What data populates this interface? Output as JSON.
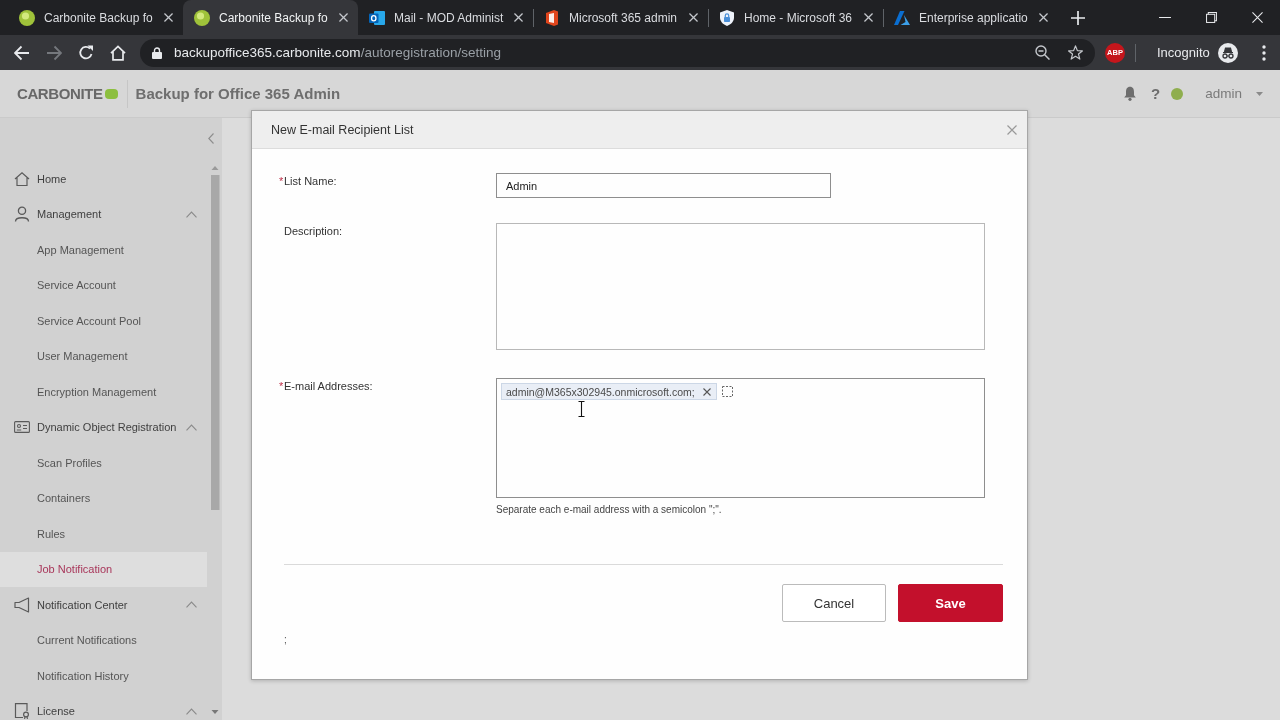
{
  "browser": {
    "tabs": [
      {
        "kind": "carbonite",
        "title": "Carbonite Backup fo",
        "selected": false
      },
      {
        "kind": "carbonite",
        "title": "Carbonite Backup fo",
        "selected": true
      },
      {
        "kind": "outlook",
        "title": "Mail - MOD Administ",
        "selected": false
      },
      {
        "kind": "office",
        "title": "Microsoft 365 admin",
        "selected": false
      },
      {
        "kind": "shield",
        "title": "Home - Microsoft 36",
        "selected": false
      },
      {
        "kind": "azure",
        "title": "Enterprise applicatio",
        "selected": false
      }
    ],
    "nav_buttons": [
      {
        "kind": "back",
        "disabled": false
      },
      {
        "kind": "forward",
        "disabled": true
      },
      {
        "kind": "reload",
        "disabled": false
      },
      {
        "kind": "home",
        "disabled": false
      }
    ],
    "url": {
      "host": "backupoffice365.carbonite.com",
      "path": "/autoregistration/setting"
    },
    "extension": "ABP",
    "profile": "Incognito"
  },
  "header": {
    "logo": "CARBONITE",
    "title": "Backup for Office 365 Admin",
    "help": "?",
    "user": "admin"
  },
  "sidebar": {
    "items": [
      {
        "kind": "home",
        "label": "Home",
        "selected": false
      },
      {
        "kind": "management",
        "label": "Management",
        "selected": false,
        "expanded": true,
        "children": [
          {
            "label": "App Management",
            "selected": false
          },
          {
            "label": "Service Account",
            "selected": false
          },
          {
            "label": "Service Account Pool",
            "selected": false
          },
          {
            "label": "User Management",
            "selected": false
          },
          {
            "label": "Encryption Management",
            "selected": false
          }
        ]
      },
      {
        "kind": "registration",
        "label": "Dynamic Object Registration",
        "selected": false,
        "expanded": true,
        "children": [
          {
            "label": "Scan Profiles",
            "selected": false
          },
          {
            "label": "Containers",
            "selected": false
          },
          {
            "label": "Rules",
            "selected": false
          },
          {
            "label": "Job Notification",
            "selected": true
          }
        ]
      },
      {
        "kind": "notifications",
        "label": "Notification Center",
        "selected": false,
        "expanded": true,
        "children": [
          {
            "label": "Current Notifications",
            "selected": false
          },
          {
            "label": "Notification History",
            "selected": false
          }
        ]
      },
      {
        "kind": "license",
        "label": "License",
        "selected": false,
        "expanded": true
      }
    ]
  },
  "dialog": {
    "title": "New E-mail Recipient List",
    "fields": [
      {
        "kind": "text",
        "required_mark": "*",
        "label": "List Name:",
        "value": "Admin"
      },
      {
        "kind": "textarea",
        "label": "Description:"
      },
      {
        "kind": "tags",
        "required_mark": "*",
        "label": "E-mail Addresses:",
        "tags": [
          "admin@M365x302945.onmicrosoft.com;"
        ],
        "help": "Separate each e-mail address with a semicolon \";\"."
      }
    ],
    "buttons": [
      {
        "kind": "secondary",
        "label": "Cancel"
      },
      {
        "kind": "primary",
        "label": "Save"
      }
    ],
    "footer_note": ";"
  }
}
